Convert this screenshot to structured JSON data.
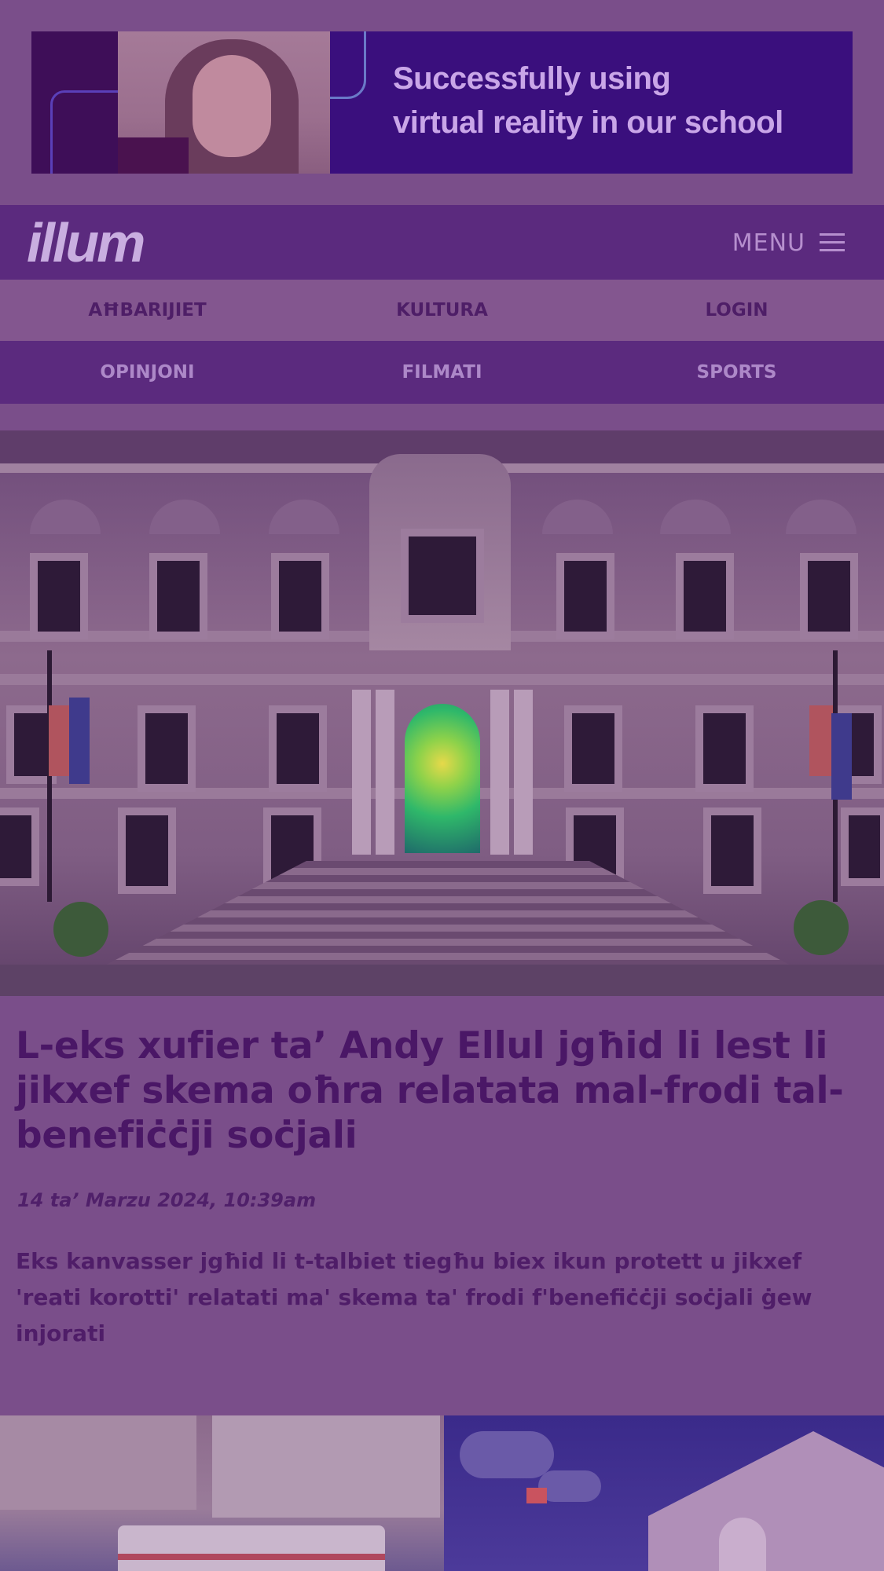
{
  "ad": {
    "headline_line1": "Successfully using",
    "headline_line2": "virtual reality in our school"
  },
  "header": {
    "logo": "illum",
    "menu_label": "MENU"
  },
  "nav": {
    "row1": [
      "AĦBARIJIET",
      "KULTURA",
      "LOGIN"
    ],
    "row2": [
      "OPINJONI",
      "FILMATI",
      "SPORTS"
    ]
  },
  "article": {
    "title": "L-eks xufier ta’ Andy Ellul jgħid li lest li jikxef skema oħra relatata mal-frodi tal-benefiċċji soċjali",
    "date": "14 ta’ Marzu 2024, 10:39am",
    "lede": "Eks kanvasser jgħid li t-talbiet tiegħu biex ikun protett u jikxef 'reati korotti' relatati ma' skema ta' frodi f'benefiċċji soċjali ġew injorati"
  },
  "colors": {
    "brand_purple": "#5b2a7e",
    "overlay_tint": "#7a4e8a",
    "title_text": "#4a1766"
  },
  "icons": {
    "menu": "hamburger-icon"
  }
}
